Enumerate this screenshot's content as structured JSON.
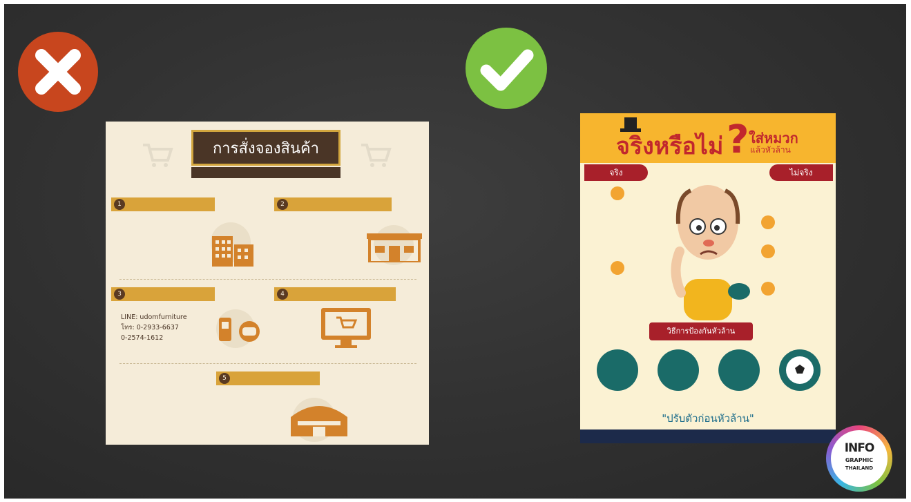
{
  "badges": {
    "wrong": "close-icon",
    "right": "check-icon"
  },
  "colors": {
    "wrong": "#c8461e",
    "right": "#7cc142",
    "gold": "#d9a33a",
    "brown": "#4a3526",
    "red": "#a8202a",
    "teal": "#1a6b68"
  },
  "left_poster": {
    "title": "การสั่งจองสินค้า",
    "subtitle": "",
    "sections": [
      {
        "num": "1",
        "ribbon": "",
        "text": ""
      },
      {
        "num": "2",
        "ribbon": "",
        "text": ""
      },
      {
        "num": "3",
        "ribbon": "",
        "text": "LINE: udomfurniture\nโทร: 0-2933-6637\n0-2574-1612\n"
      },
      {
        "num": "4",
        "ribbon": "",
        "text": ""
      },
      {
        "num": "5",
        "ribbon": "",
        "text": ""
      }
    ]
  },
  "right_poster": {
    "title_main": "จริงหรือไม่",
    "title_q": "?",
    "title_side": "ใส่หมวก",
    "title_side_sub": "แล้วหัวล้าน",
    "tab_true": "จริง",
    "tab_false": "ไม่จริง",
    "bar_label": "วิธีการป้องกันหัวล้าน",
    "quote": "\"ปรับตัวก่อนหัวล้าน\""
  },
  "logo": {
    "line1": "INFO",
    "line2": "GRAPHIC",
    "line3": "THAILAND"
  }
}
